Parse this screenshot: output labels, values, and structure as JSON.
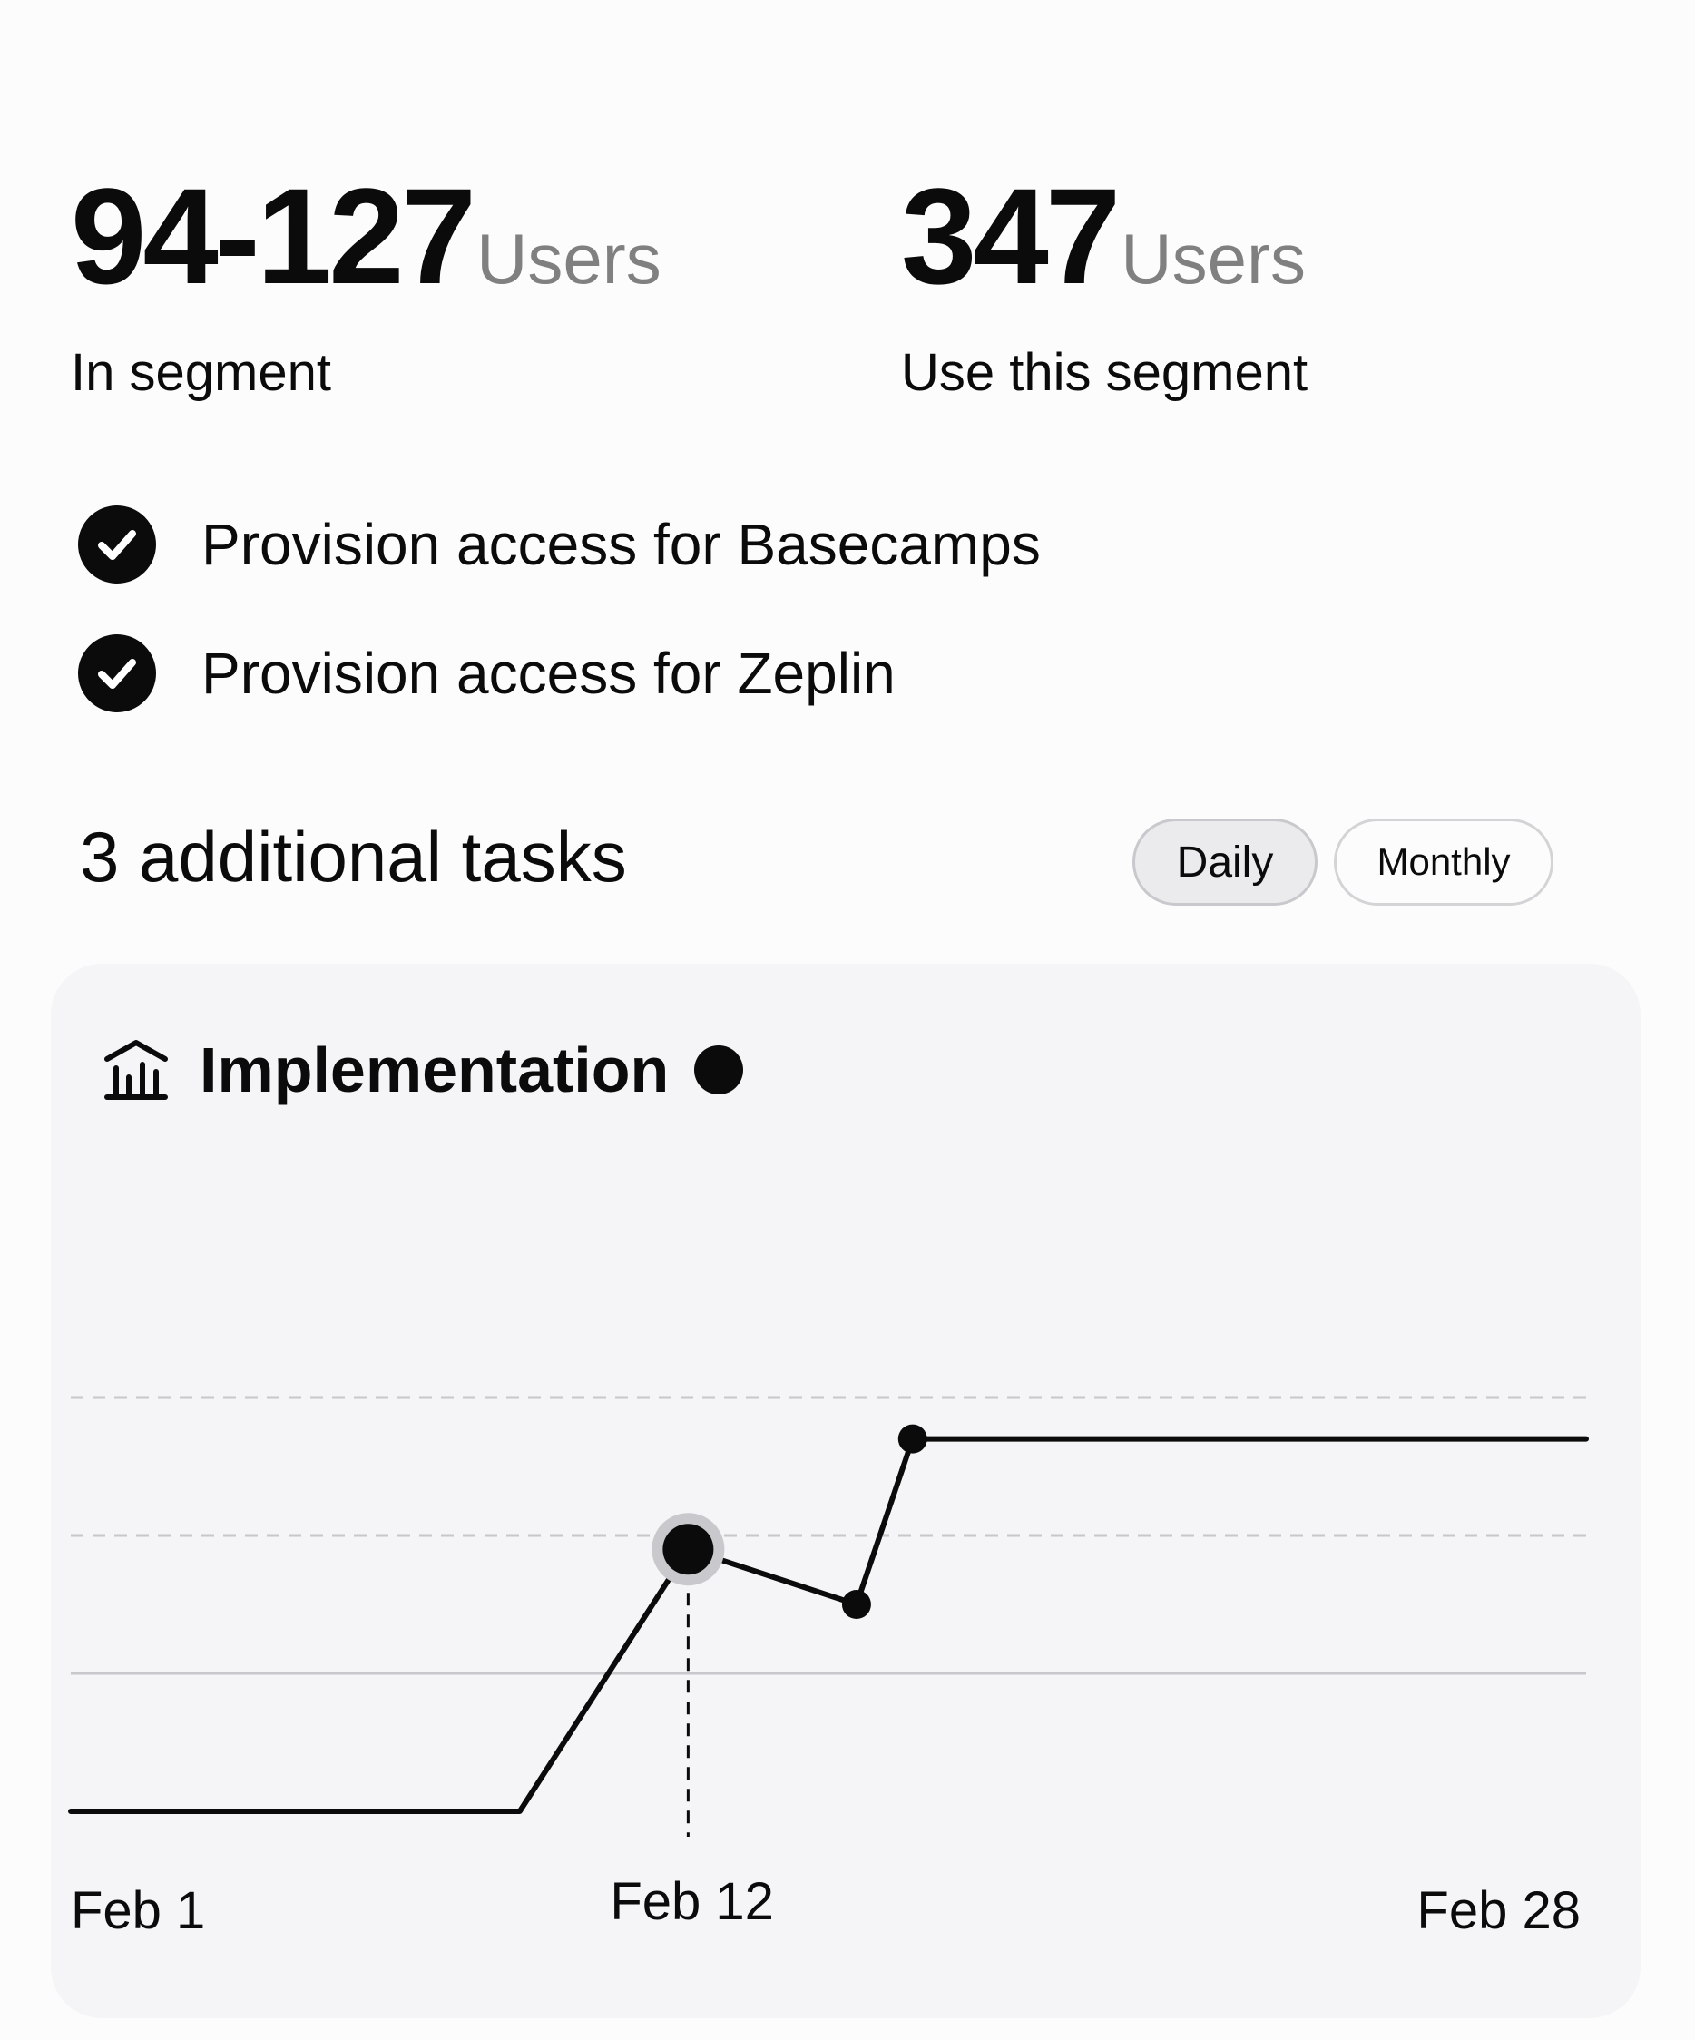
{
  "stats": [
    {
      "value": "94-127",
      "unit": "Users",
      "label": "In segment"
    },
    {
      "value": "347",
      "unit": "Users",
      "label": "Use this segment"
    }
  ],
  "tasks": [
    {
      "label": "Provision access for Basecamps",
      "icon": "check-circle-icon"
    },
    {
      "label": "Provision access for Zeplin",
      "icon": "check-circle-icon"
    }
  ],
  "section": {
    "title": "3 additional tasks",
    "toggles": {
      "daily": "Daily",
      "monthly": "Monthly",
      "selected": "Daily"
    }
  },
  "card": {
    "title": "Implementation",
    "icon": "bank-chart-icon",
    "status_color": "#0b0b0b"
  },
  "chart_data": {
    "type": "line",
    "x_ticks": [
      "Feb 1",
      "Feb 12",
      "Feb 28"
    ],
    "grid": "dashed horizontal",
    "highlighted_x": 12,
    "series": [
      {
        "x": [
          1,
          9,
          12,
          15,
          16,
          28
        ],
        "y": [
          1.0,
          1.0,
          2.9,
          2.5,
          3.7,
          3.7
        ],
        "marked_points": [
          12,
          15,
          16
        ]
      }
    ],
    "xlim": [
      1,
      28
    ],
    "ylim": [
      0.5,
      5.5
    ],
    "line_color": "#0b0b0b",
    "grid_color": "#c8c7cb"
  }
}
